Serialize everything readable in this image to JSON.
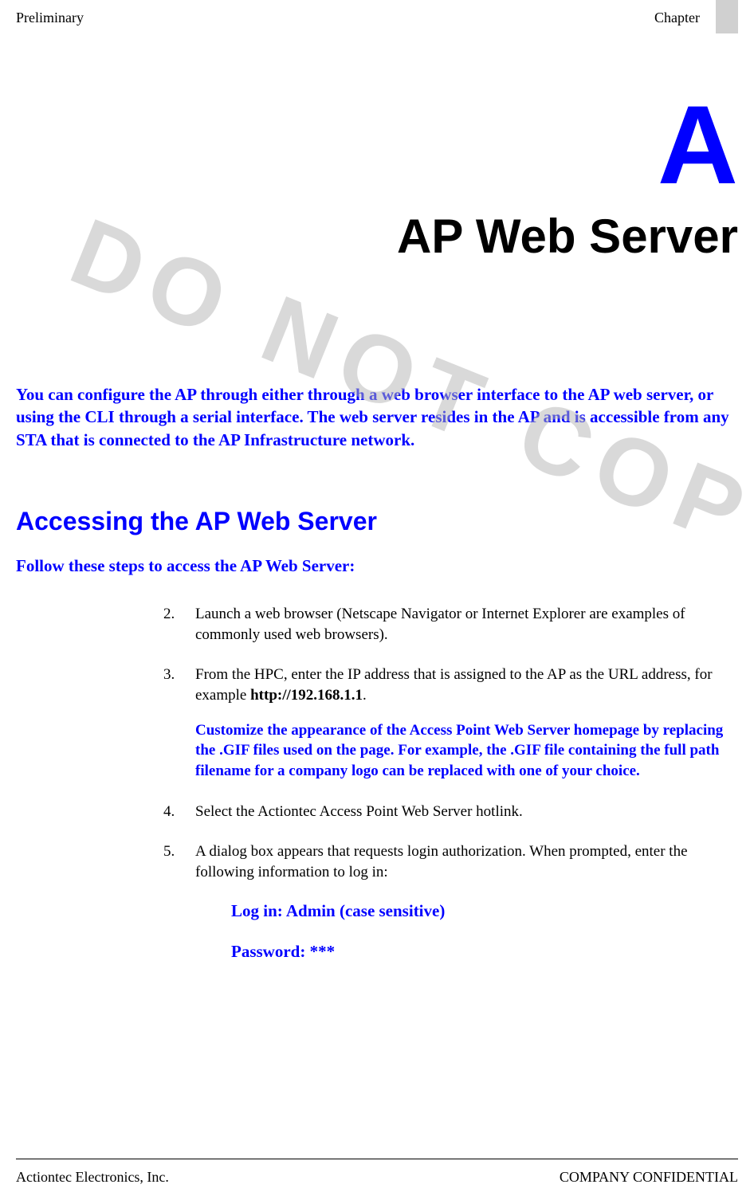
{
  "header": {
    "left": "Preliminary",
    "right": "Chapter"
  },
  "appendix_letter": "A",
  "chapter_title": "AP Web Server",
  "intro": "You can configure the AP through either through a web browser interface to the AP web server, or using the CLI through a serial interface. The web server resides in the AP and is accessible from any STA that is connected to the AP Infrastructure network.",
  "section_heading": "Accessing the AP Web Server",
  "follow_steps": "Follow these steps to access the AP Web Server:",
  "steps": {
    "s2": {
      "num": "2.",
      "text": "Launch a web browser (Netscape Navigator or Internet Explorer are examples of commonly used web browsers)."
    },
    "s3": {
      "num": "3.",
      "text_a": "From the HPC, enter the IP address that is assigned to the AP as the URL address, for example ",
      "url": "http://192.168.1.1",
      "text_b": ".",
      "blue": "Customize the appearance of the Access Point Web Server homepage by replacing the .GIF files used on the page. For example, the .GIF file containing the full path filename for a company logo can be replaced with one of your choice."
    },
    "s4": {
      "num": "4.",
      "text": "Select the Actiontec Access Point Web Server hotlink."
    },
    "s5": {
      "num": "5.",
      "text": "A dialog box appears that requests login authorization. When prompted, enter the following information to log in:",
      "login": "Log in: Admin (case sensitive)",
      "password": "Password: ***"
    }
  },
  "watermark": "DO NOT COPY",
  "footer": {
    "left": "Actiontec Electronics, Inc.",
    "right": "COMPANY CONFIDENTIAL"
  }
}
